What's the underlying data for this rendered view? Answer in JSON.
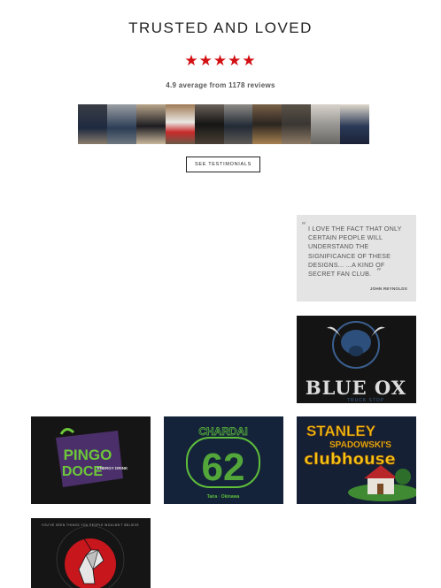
{
  "section": {
    "title": "TRUSTED AND LOVED",
    "stars": "★★★★★",
    "average_text": "4.9 average from 1178 reviews",
    "button_label": "SEE TESTIMONIALS"
  },
  "photos": [
    "customer-1",
    "customer-2",
    "customer-3",
    "customer-4",
    "customer-5",
    "customer-6",
    "customer-7",
    "customer-8",
    "customer-9",
    "customer-10"
  ],
  "quote": {
    "text": "I LOVE THE FACT THAT ONLY CERTAIN PEOPLE WILL UNDERSTAND THE SIGNIFICANCE OF THESE DESIGNS... ...A KIND OF SECRET FAN CLUB.",
    "author": "JOHN REYNOLDS"
  },
  "products": {
    "blue_ox": {
      "line1": "BLUE OX",
      "line2": "TRUCK STOP"
    },
    "pingo": {
      "line1": "PINGO",
      "line2": "DOCE",
      "sub": "ENERGY DRINK"
    },
    "chardai": {
      "top": "CHARDAI",
      "number": "62",
      "bottom": "Taira · Okinawa"
    },
    "stanley": {
      "line1": "STANLEY",
      "line2": "SPADOWSKI'S",
      "line3": "clubhouse"
    },
    "unicorn": {
      "ring_text": "YOU'VE SEEN THINGS YOU PEOPLE WOULDN'T BELIEVE"
    }
  },
  "colors": {
    "star": "#d20f13",
    "quote_bg": "#e4e4e4",
    "tile_bg": "#141414",
    "pingo_green": "#6cc73a",
    "chardai_green": "#5fbf3a",
    "stanley_yellow": "#f2c512",
    "unicorn_red": "#c8161d",
    "blue_ox": "#3a5f8f"
  }
}
